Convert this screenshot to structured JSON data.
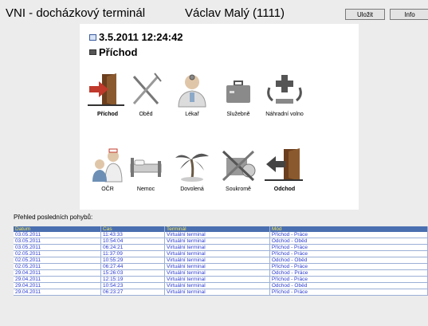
{
  "window": {
    "title": "VNI - docházkový terminál",
    "user": "Václav Malý (1111)",
    "buttons": {
      "save": "Uložit",
      "info": "Info"
    }
  },
  "status": {
    "datetime": "3.5.2011 12:24:42",
    "mode": "Příchod"
  },
  "tiles": [
    {
      "label": "Příchod",
      "icon": "door-enter-icon",
      "bold": true
    },
    {
      "label": "Oběd",
      "icon": "fork-knife-icon",
      "bold": false
    },
    {
      "label": "Lékař",
      "icon": "doctor-icon",
      "bold": false
    },
    {
      "label": "Služebně",
      "icon": "briefcase-icon",
      "bold": false
    },
    {
      "label": "Náhradní volno",
      "icon": "plus-minus-icon",
      "bold": false
    },
    {
      "label": "OČR",
      "icon": "nurse-child-icon",
      "bold": false
    },
    {
      "label": "Nemoc",
      "icon": "sickbed-icon",
      "bold": false
    },
    {
      "label": "Dovolená",
      "icon": "palm-tree-icon",
      "bold": false
    },
    {
      "label": "Soukromě",
      "icon": "private-icon",
      "bold": false
    },
    {
      "label": "Odchod",
      "icon": "door-exit-icon",
      "bold": true
    }
  ],
  "history": {
    "label": "Přehled posledních pohybů:",
    "columns": [
      "Datum",
      "Čas",
      "Terminál",
      "Mód"
    ],
    "rows": [
      [
        "03.05.2011",
        "11:43:33",
        "Virtuální terminal",
        "Příchod - Práce"
      ],
      [
        "03.05.2011",
        "10:54:04",
        "Virtuální terminal",
        "Odchod - Oběd"
      ],
      [
        "03.05.2011",
        "06:24:21",
        "Virtuální terminal",
        "Příchod - Práce"
      ],
      [
        "02.05.2011",
        "11:37:09",
        "Virtuální terminal",
        "Příchod - Práce"
      ],
      [
        "02.05.2011",
        "10:55:29",
        "Virtuální terminal",
        "Odchod - Oběd"
      ],
      [
        "02.05.2011",
        "06:27:44",
        "Virtuální terminal",
        "Příchod - Práce"
      ],
      [
        "29.04.2011",
        "15:26:03",
        "Virtuální terminal",
        "Odchod - Práce"
      ],
      [
        "29.04.2011",
        "12:15:19",
        "Virtuální terminal",
        "Příchod - Práce"
      ],
      [
        "29.04.2011",
        "10:54:23",
        "Virtuální terminal",
        "Odchod - Oběd"
      ],
      [
        "29.04.2011",
        "06:23:27",
        "Virtuální terminal",
        "Příchod - Práce"
      ]
    ]
  },
  "colors": {
    "header_bg": "#4a6fb0",
    "header_text": "#f2e65a",
    "cell_text": "#2b3bd0",
    "door_red": "#c0392b"
  }
}
